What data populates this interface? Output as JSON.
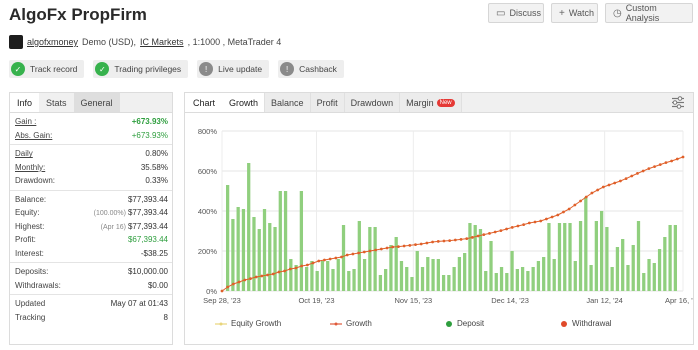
{
  "header": {
    "title": "AlgoFx PropFirm",
    "buttons": [
      {
        "label": "Discuss",
        "icon": "speech-bubble-icon"
      },
      {
        "label": "Watch",
        "icon": "plus-icon"
      },
      {
        "label": "Custom Analysis",
        "icon": "clock-icon"
      }
    ]
  },
  "account": {
    "user": "algofxmoney",
    "type": "Demo (USD),",
    "broker": "IC Markets",
    "leverage": ", 1:1000 , MetaTrader 4"
  },
  "badges": [
    {
      "label": "Track record",
      "state": "verified"
    },
    {
      "label": "Trading privileges",
      "state": "verified"
    },
    {
      "label": "Live update",
      "state": "unverified"
    },
    {
      "label": "Cashback",
      "state": "unverified"
    }
  ],
  "left_tabs": [
    "Info",
    "Stats",
    "General"
  ],
  "stats": {
    "gain_label": "Gain :",
    "gain": "+673.93%",
    "abs_gain_label": "Abs. Gain:",
    "abs_gain": "+673.93%",
    "daily_label": "Daily",
    "daily": "0.80%",
    "monthly_label": "Monthly:",
    "monthly": "35.58%",
    "drawdown_label": "Drawdown:",
    "drawdown": "0.33%",
    "balance_label": "Balance:",
    "balance": "$77,393.44",
    "equity_label": "Equity:",
    "equity_pre": "(100.00%)",
    "equity": "$77,393.44",
    "highest_label": "Highest:",
    "highest_pre": "(Apr 16)",
    "highest": "$77,393.44",
    "profit_label": "Profit:",
    "profit": "$67,393.44",
    "interest_label": "Interest:",
    "interest": "-$38.25",
    "deposits_label": "Deposits:",
    "deposits": "$10,000.00",
    "withdrawals_label": "Withdrawals:",
    "withdrawals": "$0.00",
    "updated_label": "Updated",
    "updated": "May 07 at 01:43",
    "tracking_label": "Tracking",
    "tracking": "8"
  },
  "chart_tabs": {
    "head": "Chart",
    "tabs": [
      "Growth",
      "Balance",
      "Profit",
      "Drawdown",
      "Margin"
    ],
    "new_tag": "New"
  },
  "chart_data": {
    "type": "bar",
    "y_ticks": [
      "800%",
      "600%",
      "400%",
      "200%",
      "0%"
    ],
    "ylim": [
      0,
      800
    ],
    "x_ticks": [
      "Sep 28, '23",
      "Oct 19, '23",
      "Nov 15, '23",
      "Dec 14, '23",
      "Jan 12, '24",
      "Apr 16, '24"
    ],
    "bar_color": "#90cf7e",
    "line_color": "#e0602a",
    "series": [
      {
        "name": "Equity Growth",
        "color": "#e8d57a"
      },
      {
        "name": "Growth",
        "color": "#e05a3a"
      },
      {
        "name": "Deposit",
        "color": "#2e9e3e"
      },
      {
        "name": "Withdrawal",
        "color": "#e04a2a"
      }
    ],
    "bars": [
      530,
      360,
      420,
      410,
      640,
      370,
      310,
      410,
      340,
      320,
      500,
      500,
      160,
      130,
      500,
      120,
      150,
      100,
      150,
      150,
      110,
      160,
      330,
      100,
      110,
      350,
      160,
      320,
      320,
      80,
      110,
      230,
      270,
      150,
      120,
      70,
      200,
      120,
      170,
      160,
      160,
      80,
      80,
      120,
      170,
      190,
      340,
      330,
      310,
      100,
      250,
      90,
      120,
      90,
      200,
      110,
      120,
      100,
      120,
      150,
      170,
      340,
      160,
      340,
      340,
      340,
      150,
      350,
      470,
      130,
      350,
      400,
      320,
      120,
      220,
      260,
      130,
      230,
      350,
      90,
      160,
      140,
      210,
      270,
      330,
      330
    ],
    "growth": [
      0,
      20,
      35,
      45,
      55,
      62,
      70,
      75,
      80,
      85,
      95,
      100,
      110,
      115,
      125,
      130,
      140,
      150,
      155,
      160,
      165,
      170,
      180,
      185,
      190,
      195,
      200,
      205,
      210,
      215,
      220,
      222,
      225,
      228,
      232,
      235,
      240,
      245,
      248,
      250,
      252,
      255,
      258,
      262,
      268,
      275,
      282,
      288,
      295,
      302,
      310,
      318,
      325,
      332,
      340,
      345,
      350,
      360,
      370,
      380,
      395,
      410,
      430,
      450,
      470,
      490,
      505,
      520,
      530,
      540,
      550,
      562,
      575,
      588,
      600,
      612,
      622,
      632,
      642,
      650,
      660,
      670
    ]
  }
}
